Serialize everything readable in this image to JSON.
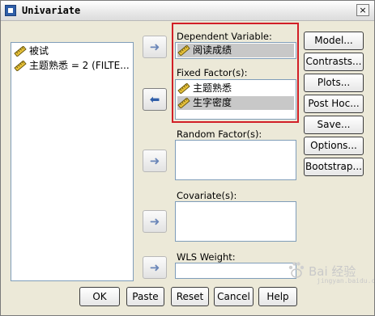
{
  "window": {
    "title": "Univariate",
    "close_glyph": "×"
  },
  "variables_list": {
    "items": [
      {
        "label": "被试",
        "icon": "scale-ruler-icon"
      },
      {
        "label": "主题熟悉 = 2 (FILTE...",
        "icon": "scale-ruler-icon"
      }
    ]
  },
  "arrow_glyph": "➜",
  "selected_arrow_glyph": "⬅",
  "dependent": {
    "label": "Dependent Variable:",
    "value": "阅读成绩"
  },
  "fixed": {
    "label": "Fixed Factor(s):",
    "items": [
      "主题熟悉",
      "生字密度"
    ]
  },
  "random": {
    "label": "Random Factor(s):"
  },
  "covariate": {
    "label": "Covariate(s):"
  },
  "wls": {
    "label": "WLS Weight:"
  },
  "side_buttons": [
    "Model...",
    "Contrasts...",
    "Plots...",
    "Post Hoc...",
    "Save...",
    "Options...",
    "Bootstrap..."
  ],
  "bottom_buttons": [
    "OK",
    "Paste",
    "Reset",
    "Cancel",
    "Help"
  ],
  "watermark": {
    "text": "Bai 经验",
    "sub": "jingyan.baidu.com"
  },
  "colors": {
    "highlight": "#d21f27",
    "dialog_bg": "#ece9d8",
    "selection": "#c8c8c8"
  }
}
